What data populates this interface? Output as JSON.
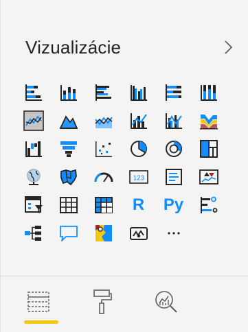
{
  "pane": {
    "title": "Vizualizácie",
    "accent_color": "#f2c811",
    "icon_blue": "#118dff",
    "icon_dark": "#605e5c"
  },
  "visuals": [
    {
      "icon": "stacked-bar-chart-icon"
    },
    {
      "icon": "stacked-column-chart-icon"
    },
    {
      "icon": "clustered-bar-chart-icon"
    },
    {
      "icon": "clustered-column-chart-icon"
    },
    {
      "icon": "100-percent-stacked-bar-chart-icon"
    },
    {
      "icon": "100-percent-stacked-column-chart-icon"
    },
    {
      "icon": "line-chart-icon",
      "selected": true
    },
    {
      "icon": "area-chart-icon"
    },
    {
      "icon": "stacked-area-chart-icon"
    },
    {
      "icon": "line-and-stacked-column-chart-icon"
    },
    {
      "icon": "line-and-clustered-column-chart-icon"
    },
    {
      "icon": "ribbon-chart-icon"
    },
    {
      "icon": "waterfall-chart-icon"
    },
    {
      "icon": "funnel-chart-icon"
    },
    {
      "icon": "scatter-chart-icon"
    },
    {
      "icon": "pie-chart-icon"
    },
    {
      "icon": "donut-chart-icon"
    },
    {
      "icon": "treemap-icon"
    },
    {
      "icon": "map-icon"
    },
    {
      "icon": "filled-map-icon"
    },
    {
      "icon": "gauge-icon"
    },
    {
      "icon": "card-icon",
      "text": "123"
    },
    {
      "icon": "multi-row-card-icon"
    },
    {
      "icon": "kpi-icon"
    },
    {
      "icon": "slicer-icon"
    },
    {
      "icon": "table-icon"
    },
    {
      "icon": "matrix-icon"
    },
    {
      "icon": "r-script-visual-icon",
      "text": "R"
    },
    {
      "icon": "python-visual-icon",
      "text": "Py"
    },
    {
      "icon": "key-influencers-icon"
    },
    {
      "icon": "decomposition-tree-icon"
    },
    {
      "icon": "qa-icon"
    },
    {
      "icon": "arcgis-map-icon"
    },
    {
      "icon": "power-apps-icon"
    },
    {
      "icon": "more-visuals-icon",
      "text": "···"
    }
  ],
  "tabs": [
    {
      "icon": "fields-tab-icon",
      "active": true
    },
    {
      "icon": "format-tab-icon"
    },
    {
      "icon": "analytics-tab-icon"
    }
  ]
}
